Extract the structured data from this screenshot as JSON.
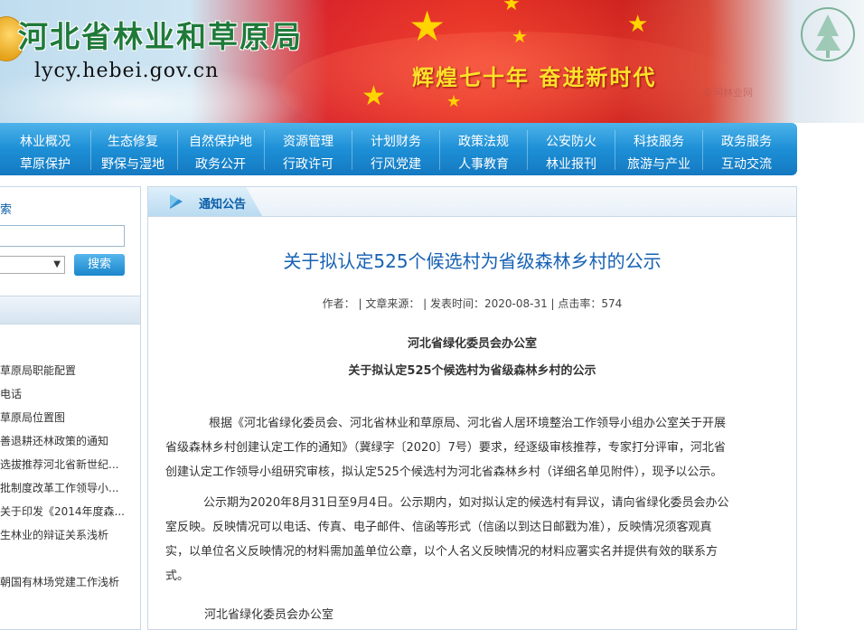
{
  "header": {
    "site_title": "河北省林业和草原局",
    "site_url": "lycy.hebei.gov.cn",
    "slogan": "辉煌七十年  奋进新时代",
    "watermark": "©河林业网"
  },
  "nav": {
    "columns": [
      {
        "top": "林业概况",
        "bottom": "草原保护"
      },
      {
        "top": "生态修复",
        "bottom": "野保与湿地"
      },
      {
        "top": "自然保护地",
        "bottom": "政务公开"
      },
      {
        "top": "资源管理",
        "bottom": "行政许可"
      },
      {
        "top": "计划财务",
        "bottom": "行风党建"
      },
      {
        "top": "政策法规",
        "bottom": "人事教育"
      },
      {
        "top": "公安防火",
        "bottom": "林业报刊"
      },
      {
        "top": "科技服务",
        "bottom": "旅游与产业"
      },
      {
        "top": "政务服务",
        "bottom": "互动交流"
      }
    ]
  },
  "sidebar": {
    "search_heading": "索",
    "search_button": "搜索",
    "items": [
      "草原局职能配置",
      "电话",
      "草原局位置图",
      "善退耕还林政策的通知",
      "选拔推荐河北省新世纪...",
      "批制度改革工作领导小...",
      "关于印发《2014年度森...",
      "生林业的辩证关系浅析",
      "",
      "朝国有林场党建工作浅析"
    ]
  },
  "main": {
    "section_title": "通知公告",
    "article_title": "关于拟认定525个候选村为省级森林乡村的公示",
    "meta": "作者：  | 文章来源：  | 发表时间：2020-08-31 | 点击率：574",
    "org": "河北省绿化委员会办公室",
    "subtitle": "关于拟认定525个候选村为省级森林乡村的公示",
    "paragraph1": [
      "根据《河北省绿化委员会、河北省林业和草原局、河北省人居环境整治工作领导小组办公室关于开展",
      "省级森林乡村创建认定工作的通知》（冀绿字〔2020〕7号）要求，经逐级审核推荐，专家打分评审，河北省",
      "创建认定工作领导小组研究审核，拟认定525个候选村为河北省森林乡村（详细名单见附件），现予以公示。"
    ],
    "paragraph2": [
      "公示期为2020年8月31日至9月4日。公示期内，如对拟认定的候选村有异议，请向省绿化委员会办公",
      "室反映。反映情况可以电话、传真、电子邮件、信函等形式（信函以到达日邮戳为准），反映情况须客观真",
      "实，以单位名义反映情况的材料需加盖单位公章，以个人名义反映情况的材料应署实名并提供有效的联系方",
      "式。"
    ],
    "signature": "河北省绿化委员会办公室"
  }
}
